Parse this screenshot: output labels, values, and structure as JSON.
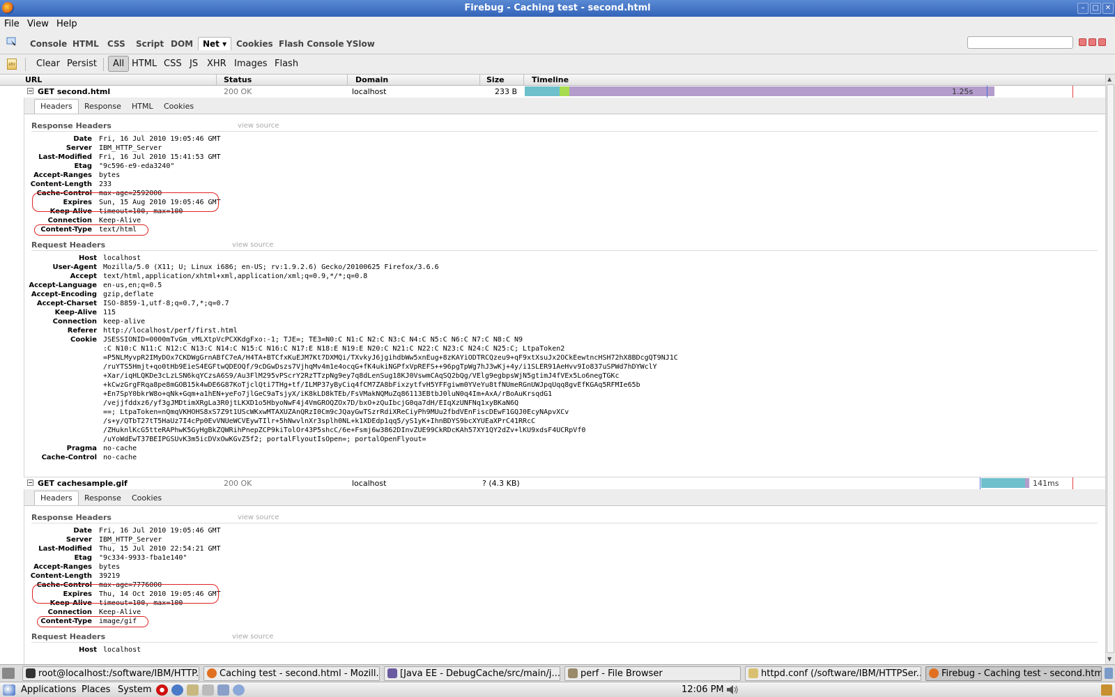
{
  "window": {
    "title": "Firebug - Caching test - second.html"
  },
  "menu": [
    "File",
    "View",
    "Help"
  ],
  "firebug_tabs": [
    "Console",
    "HTML",
    "CSS",
    "Script",
    "DOM",
    "Net ▾",
    "Cookies",
    "Flash Console",
    "YSlow"
  ],
  "net_toolbar": {
    "clear": "Clear",
    "persist": "Persist",
    "filters": [
      "All",
      "HTML",
      "CSS",
      "JS",
      "XHR",
      "Images",
      "Flash"
    ]
  },
  "columns": [
    "URL",
    "Status",
    "Domain",
    "Size",
    "Timeline"
  ],
  "requests": [
    {
      "url": "GET second.html",
      "status": "200 OK",
      "domain": "localhost",
      "size": "233 B",
      "time": "1.25s",
      "timeline_fractions": [
        0.07,
        0.02,
        0.85
      ],
      "tabs": [
        "Headers",
        "Response",
        "HTML",
        "Cookies"
      ],
      "response_title": "Response Headers",
      "view_source": "view source",
      "response_headers": [
        [
          "Date",
          "Fri, 16 Jul 2010 19:05:46 GMT"
        ],
        [
          "Server",
          "IBM_HTTP_Server"
        ],
        [
          "Last-Modified",
          "Fri, 16 Jul 2010 15:41:53 GMT"
        ],
        [
          "Etag",
          "\"9c596-e9-eda3240\""
        ],
        [
          "Accept-Ranges",
          "bytes"
        ],
        [
          "Content-Length",
          "233"
        ],
        [
          "Cache-Control",
          "max-age=2592000"
        ],
        [
          "Expires",
          "Sun, 15 Aug 2010 19:05:46 GMT"
        ],
        [
          "Keep-Alive",
          "timeout=100, max=100"
        ],
        [
          "Connection",
          "Keep-Alive"
        ],
        [
          "Content-Type",
          "text/html"
        ]
      ],
      "request_title": "Request Headers",
      "request_headers": [
        [
          "Host",
          "localhost"
        ],
        [
          "User-Agent",
          "Mozilla/5.0 (X11; U; Linux i686; en-US; rv:1.9.2.6) Gecko/20100625 Firefox/3.6.6"
        ],
        [
          "Accept",
          "text/html,application/xhtml+xml,application/xml;q=0.9,*/*;q=0.8"
        ],
        [
          "Accept-Language",
          "en-us,en;q=0.5"
        ],
        [
          "Accept-Encoding",
          "gzip,deflate"
        ],
        [
          "Accept-Charset",
          "ISO-8859-1,utf-8;q=0.7,*;q=0.7"
        ],
        [
          "Keep-Alive",
          "115"
        ],
        [
          "Connection",
          "keep-alive"
        ],
        [
          "Referer",
          "http://localhost/perf/first.html"
        ],
        [
          "Cookie",
          "JSESSIONID=0000mTvGm_vMLXtpVcPCXKdgFxo:-1; TJE=; TE3=N0:C N1:C N2:C N3:C N4:C N5:C N6:C N7:C N8:C N9\n:C N10:C N11:C N12:C N13:C N14:C N15:C N16:C N17:E N18:E N19:E N20:C N21:C N22:C N23:C N24:C N25:C; LtpaToken2\n=P5NLMyvpR2IMyDOx7CKDWgGrnABfC7eA/H4TA+BTCfxKuEJM7Kt7DXMQi/TXvkyJ6jgihdbWw5xnEug+8zKAYiODTRCQzeu9+qF9xtXsuJx2OCkEewtncHSH72hX8BDcgQT9NJ1C\n/ruYTS5Hmjt+qo0tHb9EieS4EGFtwQDEOQf/9cDGwDszs7VjhqMv4m1e4ocqG+fK4ukiNGPfxVpREFS++96pgTpWg7hJ3wKj+4y/i1SLER91AeHvv9Io837uSPWd7hDYWclY\n+Xar/iqHLQKDe3cLzLSN6kqYCzsA6S9/Au3FlM295vPScrY2RzTTzpNg9ey7q8dLenSug18KJ0VswmCAqSQ2bQg/VElg9egbpsWjN5gtimJ4fVEx5Lo6negTGKc\n+kCwzGrgFRqa8pe8mGOB15k4wDE6G87KoTjclQti7THg+tf/ILMP37yByCiq4fCM7ZA8bFixzytfvH5YFFgiwm0YVeYu8tfNUmeRGnUWJpqUqq8gvEfKGAq5RFMIe65b\n+En7SpY0bkrW8o+qNk+Gqm+a1hEN+yeFo7jlGeC9aTsjyX/iK8kLD8kTEb/FsVMakNQMuZq86113EBtbJ0luN0q4Im+AxA/rBoAuKrsqdG1\n/vejjfddxz6/yf3gJMDtimXRgLa3R0jtLKXD1o5HbyoNwF4j4VmGROQZOx7D/bxO+zQuIbcjG0qa7dH/EIqXzUNFNq1xyBKaN6Q\n==; LtpaToken=nQmqVKHOHS8xS7Z9t1UScWKxwMTAXUZAnQRzI0Cm9cJQayGwTSzrRdiXReCiyPh9MUu2fbdVEnFiscDEwF1GQJ0EcyNApvXCv\n/s+y/QTbT27tT5HaUz7I4cPp0EvVNUeWCVEywTIlr+5hNwvlnXr3splh0NL+k1XDEdp1qq5/yS1yK+IhnBDYS9bcXYUEaXPrC41RRcC\n/ZHuknlKcG5tteRAPhwK5GyHgBkZQWRihPnepZCP9kiTolOr43P5shcC/6e+Fsmj6w3862DInvZUE99CkRDcKAh57XY1QY2dZv+lKU9xdsF4UCRpVf0\n/uYoWdEwT37BEIPGSUvK3m5icDVxOwKGvZ5f2; portalFlyoutIsOpen=; portalOpenFlyout="
        ],
        [
          "Pragma",
          "no-cache"
        ],
        [
          "Cache-Control",
          "no-cache"
        ]
      ]
    },
    {
      "url": "GET cachesample.gif",
      "status": "200 OK",
      "domain": "localhost",
      "size": "? (4.3 KB)",
      "time": "141ms",
      "tabs": [
        "Headers",
        "Response",
        "Cookies"
      ],
      "response_title": "Response Headers",
      "view_source": "view source",
      "response_headers": [
        [
          "Date",
          "Fri, 16 Jul 2010 19:05:46 GMT"
        ],
        [
          "Server",
          "IBM_HTTP_Server"
        ],
        [
          "Last-Modified",
          "Thu, 15 Jul 2010 22:54:21 GMT"
        ],
        [
          "Etag",
          "\"9c334-9933-fba1e140\""
        ],
        [
          "Accept-Ranges",
          "bytes"
        ],
        [
          "Content-Length",
          "39219"
        ],
        [
          "Cache-Control",
          "max-age=7776000"
        ],
        [
          "Expires",
          "Thu, 14 Oct 2010 19:05:46 GMT"
        ],
        [
          "Keep-Alive",
          "timeout=100, max=100"
        ],
        [
          "Connection",
          "Keep-Alive"
        ],
        [
          "Content-Type",
          "image/gif"
        ]
      ],
      "request_title": "Request Headers",
      "request_headers": [
        [
          "Host",
          "localhost"
        ]
      ]
    }
  ],
  "taskbar": [
    "root@localhost:/software/IBM/HTTP...",
    "Caching test - second.html - Mozill...",
    "[Java EE - DebugCache/src/main/j...",
    "perf - File Browser",
    "httpd.conf (/software/IBM/HTTPSer...",
    "Firebug - Caching test - second.html"
  ],
  "panel": {
    "applications": "Applications",
    "places": "Places",
    "system": "System",
    "clock": "12:06 PM"
  },
  "colors": {
    "accent": "#3263b8",
    "timeline_dns": "#6ec0cc",
    "timeline_connect": "#a8dc50",
    "timeline_wait": "#b49ccc",
    "highlight_oval": "#e02020"
  }
}
